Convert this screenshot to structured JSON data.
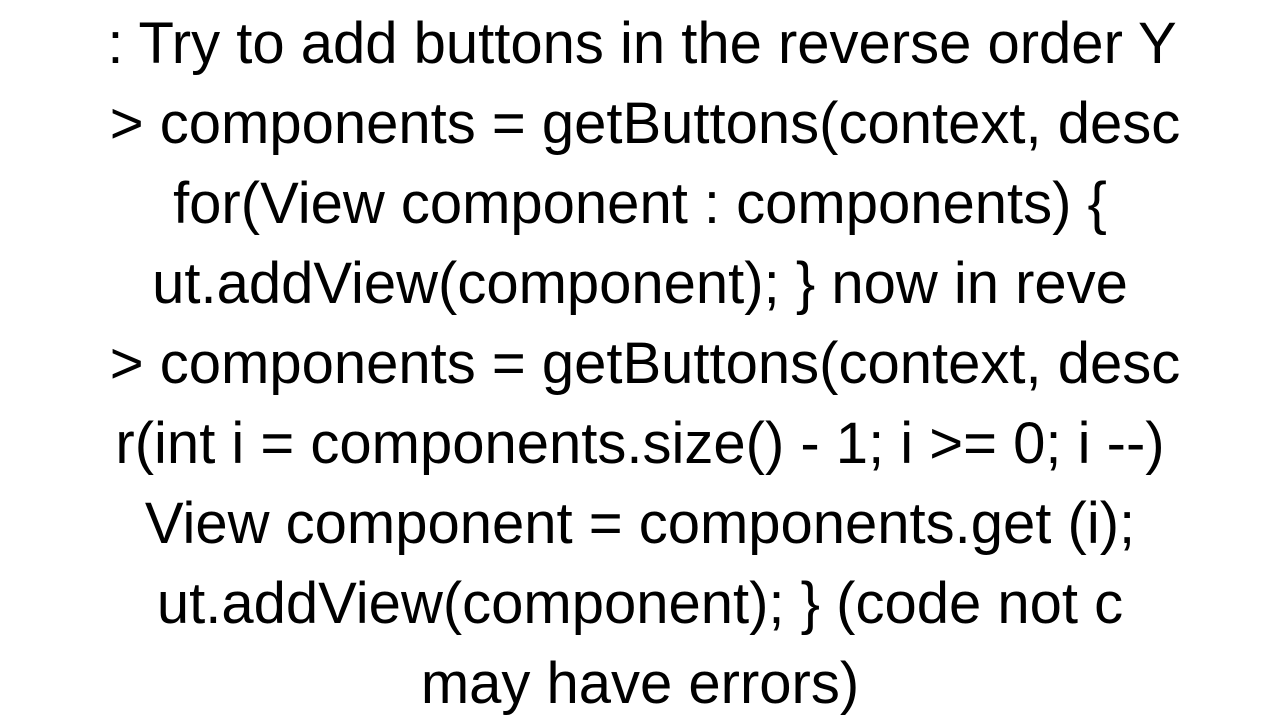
{
  "lines": {
    "l1": ": Try to add buttons in the reverse order Y",
    "l2": "> components = getButtons(context, desc",
    "l3": "for(View component : components) {",
    "l4": "ut.addView(component);     }  now in reve",
    "l5": "> components = getButtons(context, desc",
    "l6": "r(int i = components.size() - 1; i >= 0; i --)",
    "l7": "View component = components.get (i);",
    "l8": "ut.addView(component);     }  (code not c",
    "l9": "may have errors)"
  }
}
